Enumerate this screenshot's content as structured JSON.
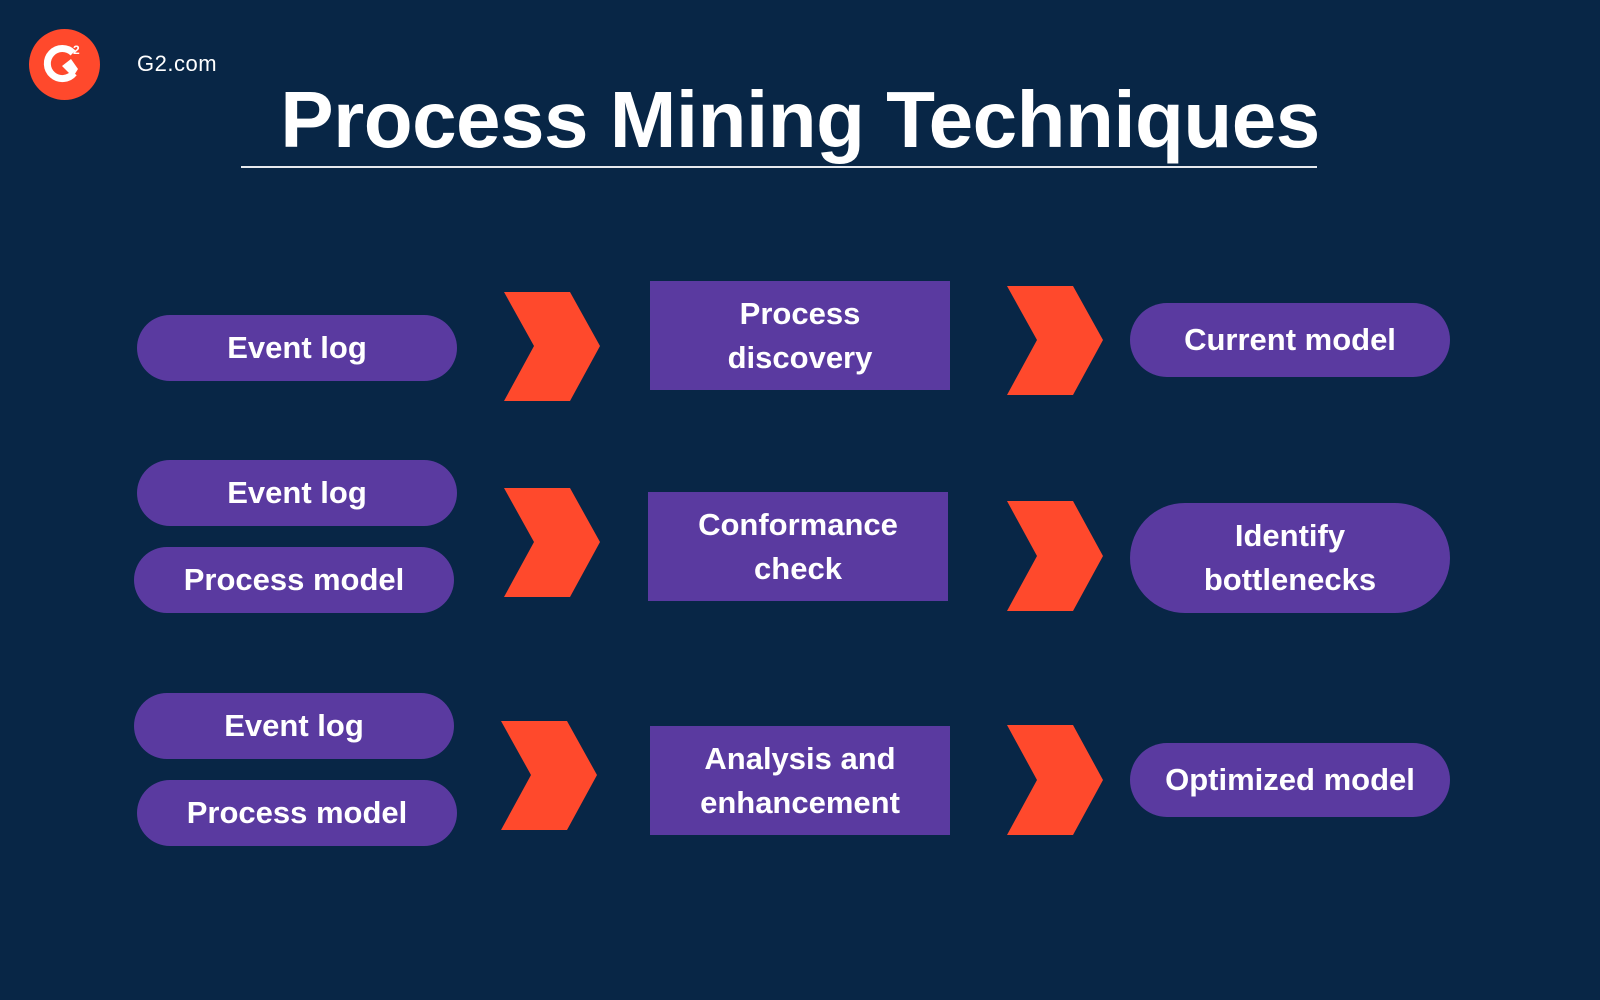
{
  "brand": {
    "logo_text": "G2",
    "site": "G2.com",
    "colors": {
      "background": "#082646",
      "node": "#5a3aa0",
      "arrow": "#ff492c",
      "text": "#ffffff"
    }
  },
  "title": "Process Mining Techniques",
  "rows": [
    {
      "inputs": [
        "Event log"
      ],
      "technique": "Process discovery",
      "output": "Current model"
    },
    {
      "inputs": [
        "Event log",
        "Process model"
      ],
      "technique": "Conformance check",
      "output": "Identify bottlenecks"
    },
    {
      "inputs": [
        "Event log",
        "Process model"
      ],
      "technique": "Analysis and enhancement",
      "output": "Optimized model"
    }
  ]
}
